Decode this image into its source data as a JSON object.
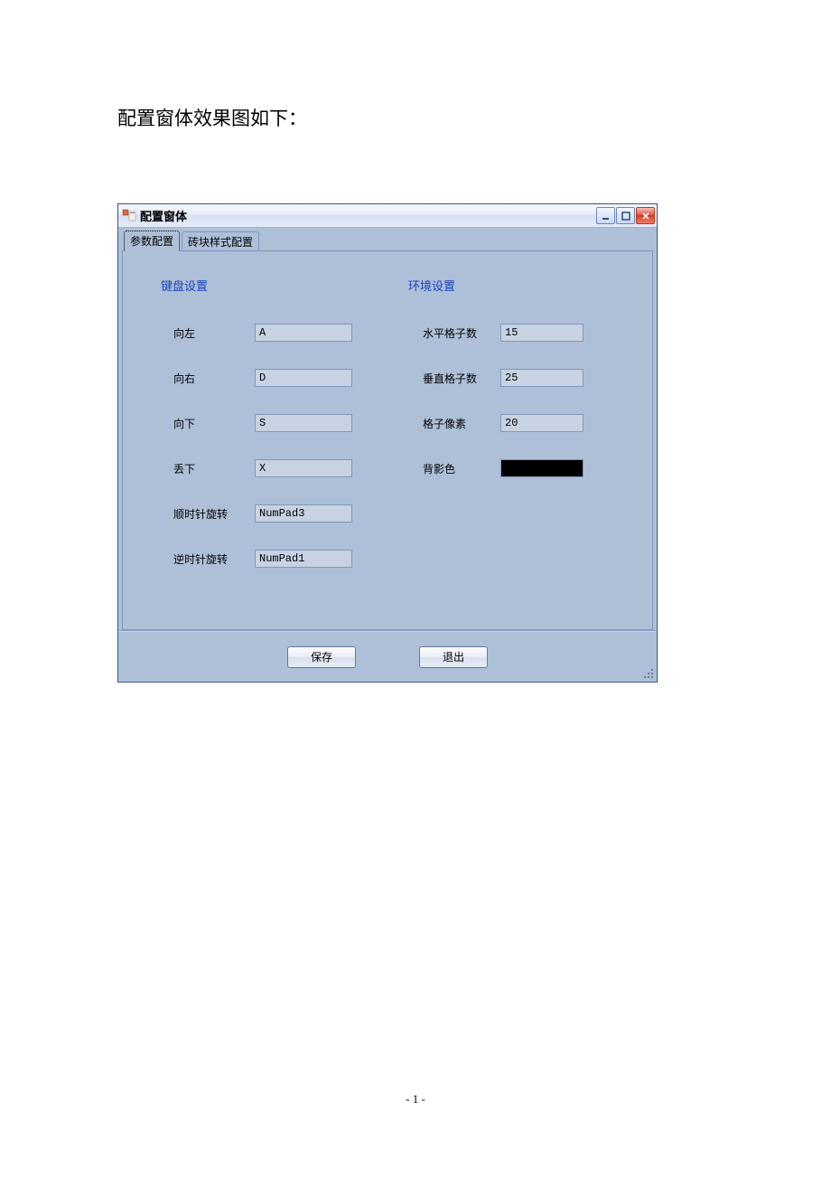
{
  "page": {
    "caption": "配置窗体效果图如下：",
    "page_number": "- 1 -"
  },
  "window": {
    "title": "配置窗体",
    "tabs": [
      {
        "label": "参数配置",
        "active": true
      },
      {
        "label": "砖块样式配置",
        "active": false
      }
    ],
    "group_keyboard": "键盘设置",
    "group_environment": "环境设置",
    "keyboard_rows": [
      {
        "label": "向左",
        "value": "A"
      },
      {
        "label": "向右",
        "value": "D"
      },
      {
        "label": "向下",
        "value": "S"
      },
      {
        "label": "丢下",
        "value": "X"
      },
      {
        "label": "顺时针旋转",
        "value": "NumPad3"
      },
      {
        "label": "逆时针旋转",
        "value": "NumPad1"
      }
    ],
    "env_rows": [
      {
        "label": "水平格子数",
        "value": "15"
      },
      {
        "label": "垂直格子数",
        "value": "25"
      },
      {
        "label": "格子像素",
        "value": "20"
      }
    ],
    "bgcolor_label": "背影色",
    "bgcolor_value": "#000000",
    "buttons": {
      "save": "保存",
      "exit": "退出"
    }
  }
}
